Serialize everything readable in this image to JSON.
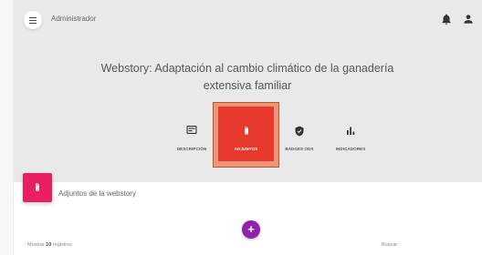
{
  "topbar": {
    "user_name": "Administrador"
  },
  "story": {
    "title": "Webstory: Adaptación al cambio climático de la ganadería extensiva familiar"
  },
  "tabs": [
    {
      "label": "DESCRIPCIÓN",
      "icon": "card-icon",
      "active": false
    },
    {
      "label": "ADJUNTOS",
      "icon": "paperclip-icon",
      "active": true
    },
    {
      "label": "BADGES ODS",
      "icon": "shield-icon",
      "active": false
    },
    {
      "label": "INDICADORES",
      "icon": "bar-chart-icon",
      "active": false
    }
  ],
  "section": {
    "label": "Adjuntos de la webstory"
  },
  "add_button": {
    "label": "+"
  },
  "table_controls": {
    "show_label": "Mostrar",
    "page_size": "10",
    "records_label": "registros",
    "search_label": "Buscar:"
  },
  "colors": {
    "header_bg": "#e9e9e9",
    "active_tab": "#e8392f",
    "highlight": "#e9967a",
    "badge": "#e91e63",
    "add_button": "#8e24aa"
  }
}
